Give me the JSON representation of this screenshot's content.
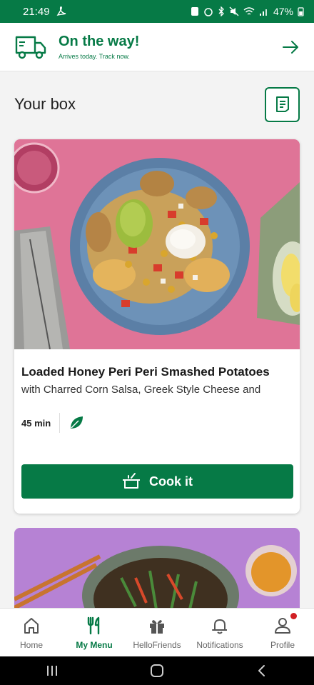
{
  "status_bar": {
    "time": "21:49",
    "battery": "47%"
  },
  "delivery": {
    "title": "On the way!",
    "subtitle": "Arrives today. Track now."
  },
  "box": {
    "title": "Your box"
  },
  "recipe": {
    "title": "Loaded Honey Peri Peri Smashed Potatoes",
    "subtitle": "with Charred Corn Salsa, Greek Style Cheese and",
    "time": "45 min",
    "cook_label": "Cook it"
  },
  "nav": {
    "items": [
      {
        "label": "Home",
        "icon": "home-icon",
        "active": false
      },
      {
        "label": "My Menu",
        "icon": "fork-knife-icon",
        "active": true
      },
      {
        "label": "HelloFriends",
        "icon": "gift-icon",
        "active": false
      },
      {
        "label": "Notifications",
        "icon": "bell-icon",
        "active": false
      },
      {
        "label": "Profile",
        "icon": "profile-icon",
        "active": false
      }
    ]
  },
  "colors": {
    "brand_green": "#067a46",
    "badge_red": "#d11f24"
  }
}
